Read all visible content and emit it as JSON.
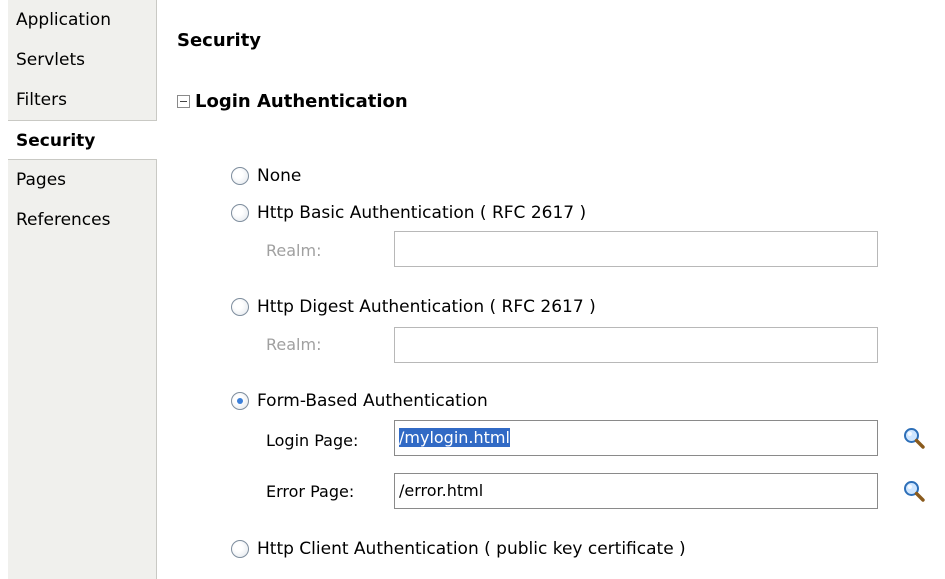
{
  "sidebar": {
    "items": [
      {
        "label": "Application"
      },
      {
        "label": "Servlets"
      },
      {
        "label": "Filters"
      },
      {
        "label": "Security"
      },
      {
        "label": "Pages"
      },
      {
        "label": "References"
      }
    ],
    "selected": "Security"
  },
  "main": {
    "title": "Security",
    "section_title": "Login Authentication",
    "options": {
      "none": "None",
      "basic": "Http Basic Authentication ( RFC 2617 )",
      "digest": "Http Digest Authentication ( RFC 2617 )",
      "form": "Form-Based Authentication",
      "client": "Http Client Authentication ( public key certificate )"
    },
    "selected_option": "form",
    "realm_label": "Realm:",
    "basic_realm_value": "",
    "digest_realm_value": "",
    "login_page_label": "Login Page:",
    "login_page_value": "/mylogin.html",
    "error_page_label": "Error Page:",
    "error_page_value": "/error.html"
  },
  "colors": {
    "sidebar_bg": "#f0f0ed",
    "selection": "#316ac5",
    "radio_dot": "#3b7fd9",
    "disabled_text": "#a0a0a0"
  },
  "icons": {
    "collapse": "collapse-minus-icon",
    "browse": "magnifier-icon"
  }
}
